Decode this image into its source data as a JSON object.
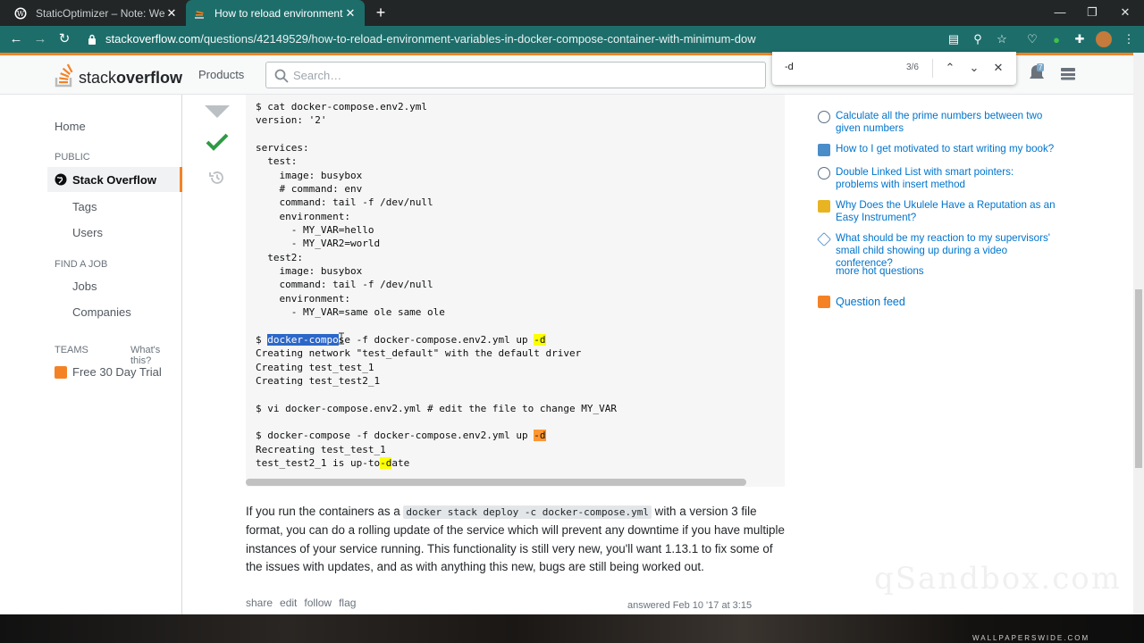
{
  "browser": {
    "tabs": [
      {
        "title": "StaticOptimizer – Note: We're in"
      },
      {
        "title": "How to reload environment varia"
      }
    ],
    "url_host": "stackoverflow.com",
    "url_path": "/questions/42149529/how-to-reload-environment-variables-in-docker-compose-container-with-minimum-dow",
    "find": {
      "query": "-d",
      "count": "3/6"
    },
    "extension_badge": "7"
  },
  "header": {
    "logo_plain": "stack",
    "logo_bold": "overflow",
    "products": "Products",
    "search_placeholder": "Search…"
  },
  "leftnav": {
    "home": "Home",
    "public": "PUBLIC",
    "stackoverflow": "Stack Overflow",
    "tags": "Tags",
    "users": "Users",
    "find_a_job": "FIND A JOB",
    "jobs": "Jobs",
    "companies": "Companies",
    "teams": "TEAMS",
    "whats_this": "What's this?",
    "trial": "Free 30 Day Trial"
  },
  "code": {
    "l1": "$ cat docker-compose.env2.yml",
    "l2": "version: '2'",
    "l4": "services:",
    "l5": "  test:",
    "l6": "    image: busybox",
    "l7": "    # command: env",
    "l8": "    command: tail -f /dev/null",
    "l9": "    environment:",
    "l10": "      - MY_VAR=hello",
    "l11": "      - MY_VAR2=world",
    "l12": "  test2:",
    "l13": "    image: busybox",
    "l14": "    command: tail -f /dev/null",
    "l15": "    environment:",
    "l16": "      - MY_VAR=same ole same ole",
    "l18a": "$ ",
    "l18sel": "docker-compo",
    "l18b": "se -f docker-compose.env2.yml up ",
    "l18hl": "-d",
    "l19": "Creating network \"test_default\" with the default driver",
    "l20": "Creating test_test_1",
    "l21": "Creating test_test2_1",
    "l23": "$ vi docker-compose.env2.yml # edit the file to change MY_VAR",
    "l25a": "$ docker-compose -f docker-compose.env2.yml up ",
    "l25hl": "-d",
    "l26": "Recreating test_test_1",
    "l27a": "test_test2_1 is up-to",
    "l27hl": "-d",
    "l27b": "ate"
  },
  "answer": {
    "p_a": "If you run the containers as a ",
    "p_code": "docker stack deploy -c docker-compose.yml",
    "p_b": " with a version 3 file format, you can do a rolling update of the service which will prevent any downtime if you have multiple instances of your service running. This functionality is still very new, you'll want 1.13.1 to fix some of the issues with updates, and as with anything this new, bugs are still being worked out.",
    "share": "share",
    "edit": "edit",
    "follow": "follow",
    "flag": "flag",
    "answered": "answered Feb 10 '17 at 3:15"
  },
  "hot_questions": [
    {
      "title": "Calculate all the prime numbers between two given numbers",
      "site_color": "#5a6f85"
    },
    {
      "title": "How to I get motivated to start writing my book?",
      "site_color": "#4b8dc8"
    },
    {
      "title": "Double Linked List with smart pointers: problems with insert method",
      "site_color": "#5a6f85"
    },
    {
      "title": "Why Does the Ukulele Have a Reputation as an Easy Instrument?",
      "site_color": "#e8b422"
    },
    {
      "title": "What should be my reaction to my supervisors' small child showing up during a video conference?",
      "site_color": "#3b83c8"
    }
  ],
  "more_hot": "more hot questions",
  "question_feed": "Question feed",
  "watermark": "qSandbox.com",
  "desktop_watermark": "WALLPAPERSWIDE.COM",
  "colors": {
    "accent": "#f48225",
    "link": "#0074cc",
    "chrome": "#1d6e6b"
  }
}
